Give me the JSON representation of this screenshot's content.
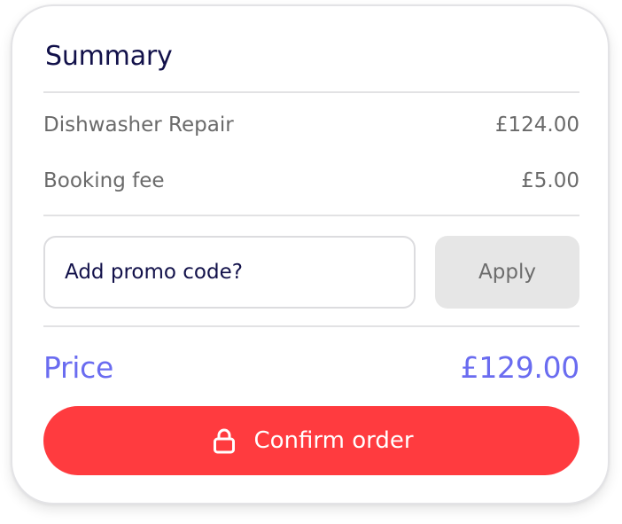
{
  "summary": {
    "title": "Summary",
    "items": [
      {
        "label": "Dishwasher Repair",
        "amount": "£124.00"
      },
      {
        "label": "Booking fee",
        "amount": "£5.00"
      }
    ]
  },
  "promo": {
    "placeholder": "Add promo code?",
    "apply_label": "Apply"
  },
  "total": {
    "label": "Price",
    "amount": "£129.00"
  },
  "confirm": {
    "label": "Confirm order",
    "icon": "lock-icon"
  },
  "colors": {
    "title": "#12114a",
    "price": "#6a6cf0",
    "confirm_bg": "#ff3b3f",
    "apply_bg": "#e6e6e6"
  }
}
